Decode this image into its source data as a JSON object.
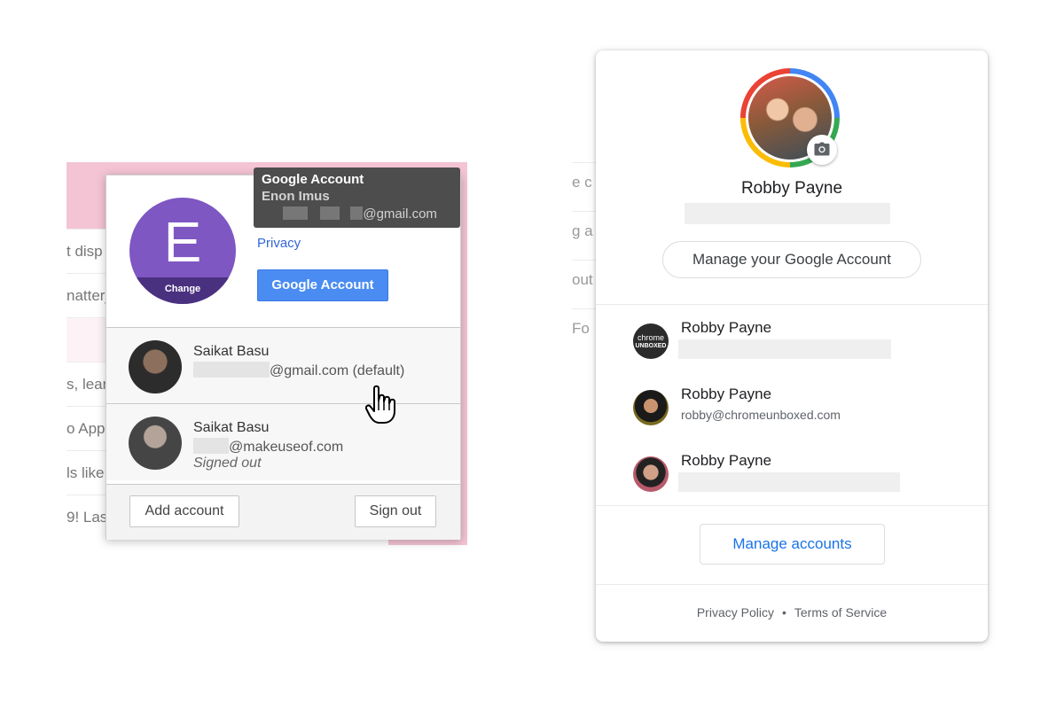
{
  "left_popup": {
    "background_rows": [
      "t disp",
      "natterj",
      "",
      "s, lear",
      "o App",
      "ls like",
      "9! Las"
    ],
    "tooltip": {
      "title": "Google Account",
      "name": "Enon Imus",
      "email_suffix": "@gmail.com"
    },
    "avatar_letter": "E",
    "avatar_change_label": "Change",
    "privacy_link": "Privacy",
    "google_account_button": "Google Account",
    "accounts": [
      {
        "name": "Saikat Basu",
        "email_suffix": "@gmail.com (default)",
        "status": ""
      },
      {
        "name": "Saikat Basu",
        "email_suffix": "@makeuseof.com",
        "status": "Signed out"
      }
    ],
    "add_account_button": "Add account",
    "sign_out_button": "Sign out"
  },
  "right_popup": {
    "background_rows": [
      "e c",
      "g a",
      "out",
      "Fo"
    ],
    "profile_name": "Robby Payne",
    "manage_account_button": "Manage your Google Account",
    "accounts": [
      {
        "name": "Robby Payne",
        "email": "",
        "avatar_text_top": "chrome",
        "avatar_text_bottom": "UNBOXED"
      },
      {
        "name": "Robby Payne",
        "email": "robby@chromeunboxed.com"
      },
      {
        "name": "Robby Payne",
        "email": ""
      }
    ],
    "manage_accounts_button": "Manage accounts",
    "footer": {
      "privacy_policy": "Privacy Policy",
      "separator": "•",
      "terms": "Terms of Service"
    }
  },
  "colors": {
    "old_avatar": "#7e57c2",
    "old_blue_button": "#4a8cf1",
    "new_link_blue": "#1a73e8",
    "pink_background": "#f4c4d4"
  },
  "icons": {
    "camera": "camera-icon",
    "cursor": "hand-pointer-icon"
  }
}
